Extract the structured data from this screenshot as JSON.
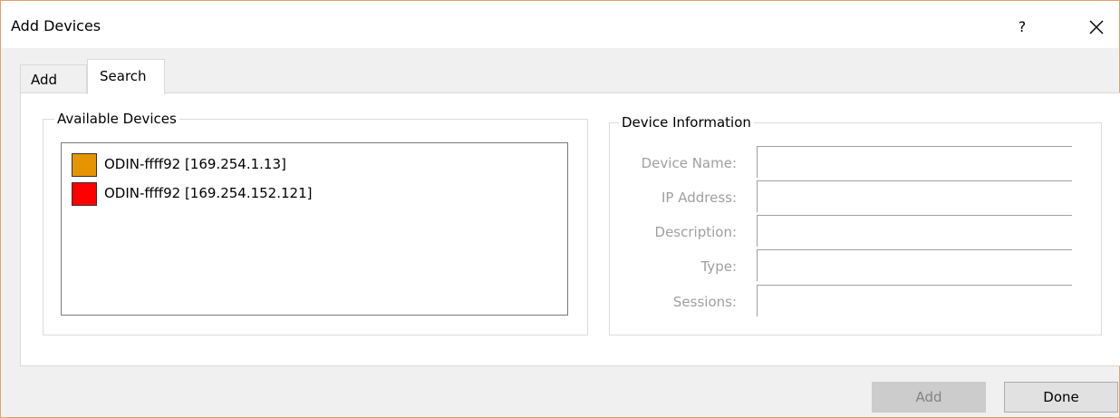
{
  "window": {
    "title": "Add Devices",
    "help_label": "?",
    "close_label": "×"
  },
  "tabs": [
    {
      "label": "Add",
      "active": false
    },
    {
      "label": "Search",
      "active": true
    }
  ],
  "available_devices": {
    "group_label": "Available Devices",
    "items": [
      {
        "label": "ODIN-ffff92 [169.254.1.13]",
        "color": "#e69500"
      },
      {
        "label": "ODIN-ffff92 [169.254.152.121]",
        "color": "#ff0000"
      }
    ]
  },
  "device_information": {
    "group_label": "Device Information",
    "fields": [
      {
        "label": "Device Name:",
        "value": ""
      },
      {
        "label": "IP Address:",
        "value": ""
      },
      {
        "label": "Description:",
        "value": ""
      },
      {
        "label": "Type:",
        "value": ""
      },
      {
        "label": "Sessions:",
        "value": ""
      }
    ]
  },
  "buttons": {
    "add_label": "Add",
    "done_label": "Done"
  }
}
